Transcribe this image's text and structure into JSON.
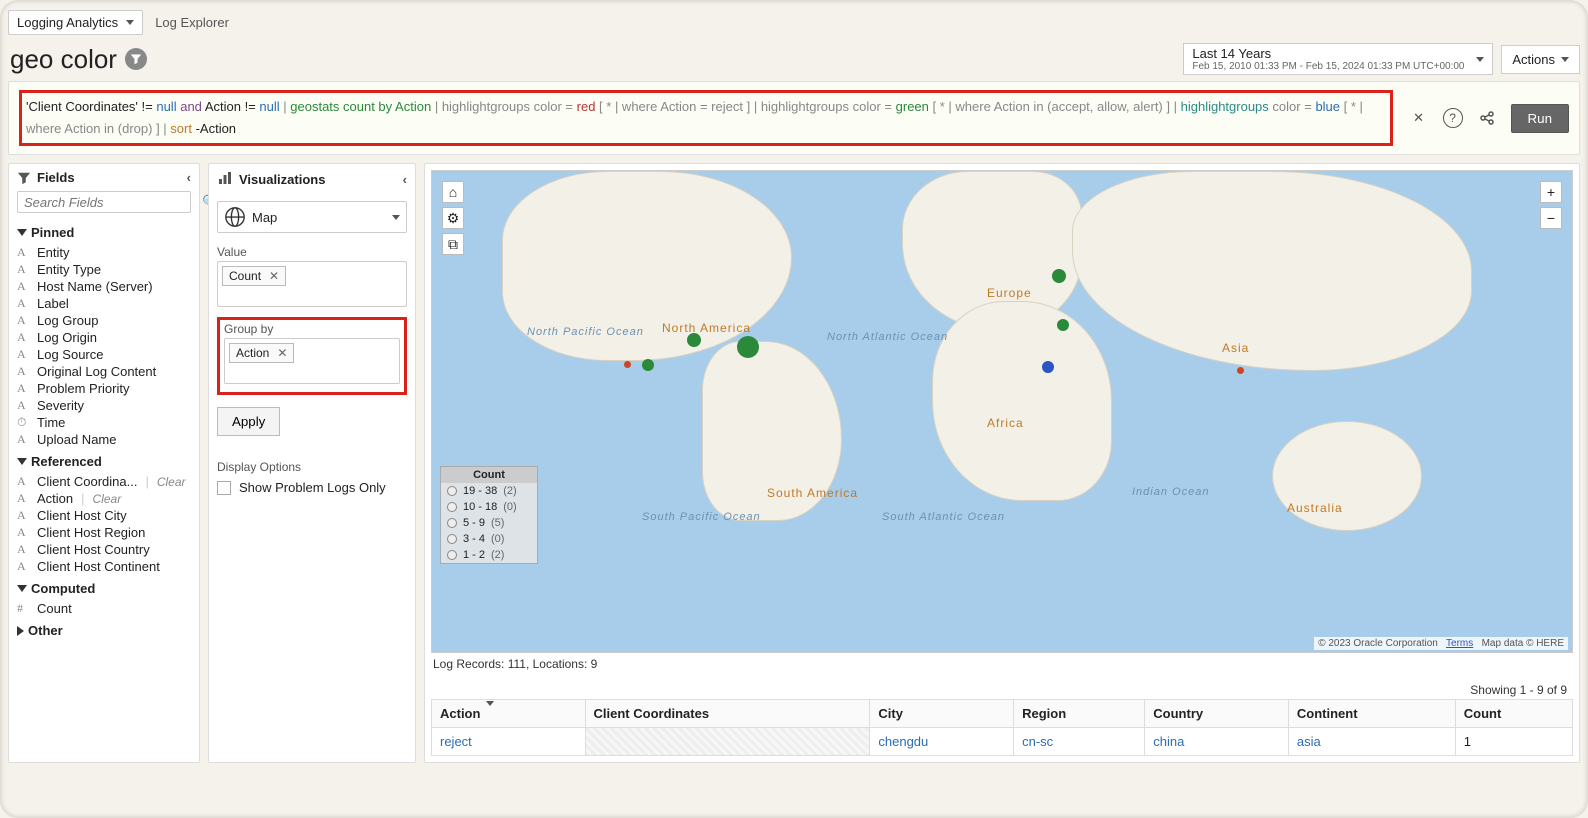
{
  "topbar": {
    "service": "Logging Analytics",
    "breadcrumb": "Log Explorer"
  },
  "title": "geo color",
  "time": {
    "label": "Last 14 Years",
    "range": "Feb 15, 2010 01:33 PM - Feb 15, 2024 01:33 PM UTC+00:00"
  },
  "actions_label": "Actions",
  "query": {
    "p1": "'Client Coordinates' != ",
    "null1": "null",
    "and": "and",
    "p2": " Action != ",
    "null2": "null",
    "geostats": " geostats count by Action ",
    "hg": "highlightgroups",
    "color": "color",
    "eq": " = ",
    "red": "red",
    "green": "green",
    "blue": "blue",
    "g1": " [ * | where Action = reject ] ",
    "g2": " [ * | where Action in (accept, allow, alert) ] ",
    "g3": " [ * | where Action in (drop) ] ",
    "sort": " sort",
    "sortarg": " -Action"
  },
  "query_actions": {
    "run": "Run"
  },
  "fields": {
    "title": "Fields",
    "search_ph": "Search Fields",
    "pinned_title": "Pinned",
    "pinned": [
      "Entity",
      "Entity Type",
      "Host Name (Server)",
      "Label",
      "Log Group",
      "Log Origin",
      "Log Source",
      "Original Log Content",
      "Problem Priority",
      "Severity",
      "Time",
      "Upload Name"
    ],
    "ref_title": "Referenced",
    "ref": [
      {
        "name": "Client Coordina...",
        "clear": true
      },
      {
        "name": "Action",
        "clear": true
      },
      {
        "name": "Client Host City"
      },
      {
        "name": "Client Host Region"
      },
      {
        "name": "Client Host Country"
      },
      {
        "name": "Client Host Continent"
      }
    ],
    "clear_label": "Clear",
    "computed_title": "Computed",
    "computed": [
      "Count"
    ],
    "other_title": "Other"
  },
  "viz": {
    "title": "Visualizations",
    "type": "Map",
    "value_label": "Value",
    "value_chip": "Count",
    "group_label": "Group by",
    "group_chip": "Action",
    "apply": "Apply",
    "disp_title": "Display Options",
    "show_problem": "Show Problem Logs Only"
  },
  "map": {
    "labels": {
      "na": "North America",
      "sa": "South America",
      "eu": "Europe",
      "af": "Africa",
      "as": "Asia",
      "au": "Australia"
    },
    "oceans": {
      "np": "North Pacific Ocean",
      "na": "North Atlantic Ocean",
      "sp": "South Pacific Ocean",
      "sa": "South Atlantic Ocean",
      "io": "Indian Ocean"
    },
    "legend_title": "Count",
    "legend": [
      {
        "range": "19 - 38",
        "count": "(2)"
      },
      {
        "range": "10 - 18",
        "count": "(0)"
      },
      {
        "range": "5 - 9",
        "count": "(5)"
      },
      {
        "range": "3 - 4",
        "count": "(0)"
      },
      {
        "range": "1 - 2",
        "count": "(2)"
      }
    ],
    "records": "Log Records: 111, Locations: 9",
    "copyright": "© 2023 Oracle Corporation",
    "terms": "Terms",
    "mapdata": "Map data © HERE"
  },
  "table": {
    "showing": "Showing 1 - 9 of 9",
    "headers": [
      "Action",
      "Client Coordinates",
      "City",
      "Region",
      "Country",
      "Continent",
      "Count"
    ],
    "row": {
      "action": "reject",
      "coords": "",
      "city": "chengdu",
      "region": "cn-sc",
      "country": "china",
      "continent": "asia",
      "count": "1"
    }
  }
}
